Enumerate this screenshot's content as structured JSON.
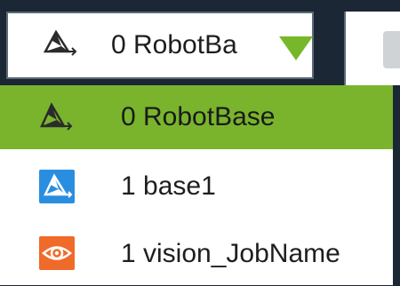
{
  "combo": {
    "selected_text": "0 RobotBa",
    "icon": "robot-base-frame-icon",
    "arrow_color": "#76b82a"
  },
  "dropdown": {
    "highlight_color": "#7ab42d",
    "items": [
      {
        "label": "0 RobotBase",
        "icon": "robot-base-frame-icon",
        "selected": true
      },
      {
        "label": "1 base1",
        "icon": "user-base-frame-icon",
        "icon_color": "#2a8ee0"
      },
      {
        "label": "1 vision_JobName",
        "icon": "vision-eye-icon",
        "icon_color": "#f06a2a"
      }
    ]
  }
}
